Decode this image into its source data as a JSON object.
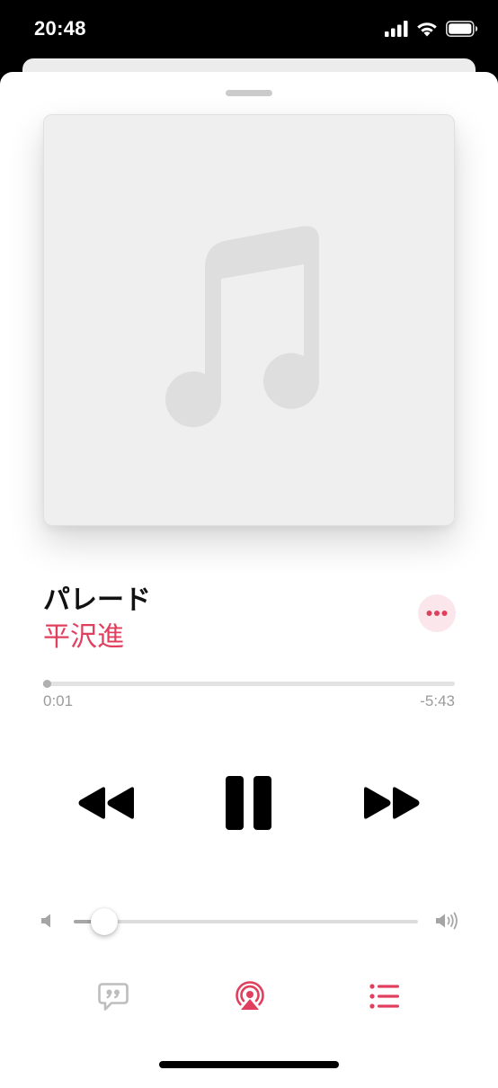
{
  "status_bar": {
    "time": "20:48",
    "icons": [
      "cellular-signal-icon",
      "wifi-icon",
      "battery-icon"
    ]
  },
  "now_playing": {
    "artwork_placeholder_icon": "music-note-icon",
    "title": "パレード",
    "artist": "平沢進",
    "more_icon": "ellipsis-icon",
    "progress": {
      "elapsed": "0:01",
      "remaining": "-5:43",
      "fraction": 0.003
    }
  },
  "transport": {
    "rewind_icon": "rewind-icon",
    "play_pause_icon": "pause-icon",
    "forward_icon": "fast-forward-icon"
  },
  "volume": {
    "level": 0.09,
    "min_icon": "speaker-low-icon",
    "max_icon": "speaker-high-icon"
  },
  "bottom_bar": {
    "lyrics_icon": "lyrics-quote-icon",
    "airplay_icon": "airplay-icon",
    "queue_icon": "up-next-list-icon"
  },
  "colors": {
    "accent": "#e0405e",
    "accent_soft": "#fbe7eb",
    "text": "#111111",
    "secondary_text": "#9b9b9b"
  }
}
